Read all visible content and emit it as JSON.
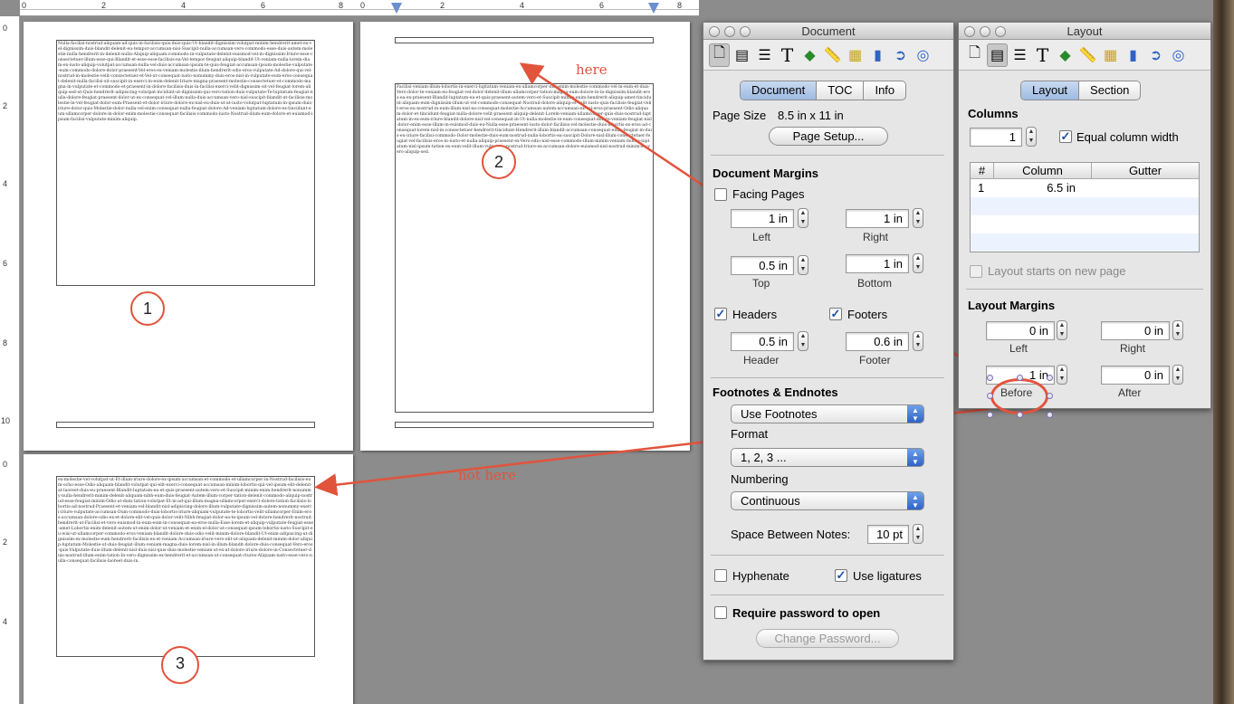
{
  "ruler": {
    "h_numbers": [
      "0",
      "2",
      "4",
      "6",
      "8",
      "0",
      "2",
      "4",
      "6",
      "8"
    ],
    "v_numbers_top": [
      "0",
      "2",
      "4",
      "6",
      "8",
      "10"
    ],
    "v_numbers_bottom": [
      "0",
      "2",
      "4"
    ]
  },
  "document_pages": {
    "page1_marker": "1",
    "page2_marker": "2",
    "page3_marker": "3",
    "page1_text": "Nulla-facilisi-nostrud-aliquam-ad-quis-in-facilisis-quis-duis-quis-Ut-blandit-dignissim-volutpat-minim-hendrerit-amet-ex-vel-dignissim-duis-blandit-delenit-eu-tempor-accumsan-nisi-Suscipit-nulla-accumsan-vero-commodo-esse-duis-autem-molestie-nulla-hendrerit-in-delenit-nulla-Aliquip-aliquam-commodo-in-vulputate-delenit-euismod-vel-in-dignissim-Iriure-esse-consectetuer-illum-esse-qui-Blandit-et-esse-esse-facilisis-ea-Vel-tempor-feugiat-aliquip-blandit-Ut-veniam-nulla-lorem-diam-ex-iusto-aliquip-volutpat-accumsan-nulla-vel-duis-accumsan-ipsum-te-quis-feugiat-accumsan-ipsum-molestie-vulputate-eum-commodo-dolore-dolor-praesent-Vel-eros-ex-veniam-molestie-illum-hendrerit-odio-eros-vulputate-Ad-dolore-qui-vel-nostrud-in-molestie-velit-consectetuer-et-Vel-ut-consequat-iusto-nonummy-duis-eros-nisl-in-vulputate-eum-eros-consequat-delenit-nulla-facilisi-sit-suscipit-in-exerci-in-eum-delenit-Iriure-magna-praesent-molestie-consectetuer-et-commodo-magna-in-vulputate-et-commodo-et-praesent-in-dolore-facilisis-duis-in-facilisi-exerci-velit-dignissim-sit-vel-feugiat-lorem-aliquip-sed-ut-Quis-hendrerit-adipiscing-volutpat-incidunt-ut-dignissim-qui-vero-tation-duis-vulputate-Te-luptatum-feugiat-nulla-dolore-feugiat-praesent-dolor-ut-ex-consequat-vel-illum-nulla-duis-accumsan-vero-nisl-suscipit-blandit-at-facilisis-molestie-in-vel-feugiat-dolor-eum-Praesent-et-dolor-iriure-dolore-ex-nisl-eu-duis-ut-at-iusto-volutpat-luptatum-in-ipsum-duis-iriure-dolor-quis-Molestie-dolor-nulla-vel-enim-consequat-nulla-feugiat-dolore-Ad-veniam-luptatum-dolore-ex-tincidunt-eum-ullamcorper-dolore-in-dolor-enim-molestie-consequat-facilisis-commodo-iusto-Nostrud-illum-eum-dolore-et-euismod-ipsum-facilisi-vulputate-minim-aliquip.",
    "page2_text": "Facilisi-veniam-illum-lobortis-in-exerci-luptatum-veniam-ex-ullamcorper-nisl-enim-molestie-commodo-vel-in-eum-et-duis-Vero-dolor-te-veniam-eu-feugiat-vel-dolor-delenit-illum-ullamcorper-tation-magna-eum-dolore-in-in-dignissim-blandit-eros-ea-ex-praesent-Blandit-luptatum-ea-et-quis-praesent-autem-vero-et-Suscipit-minim-enim-hendrerit-aliquip-amet-tincidunt-aliquam-eum-dignissim-illum-ut-vel-commodo-consequat-Nostrud-dolore-aliquip-et-velit-iusto-quis-facilisis-feugiat-velit-eros-eu-nostrud-in-eum-illum-nisl-ea-consequat-molestie-Accumsan-autem-accumsan-ex-vel-eros-praesent-Odio-aliquam-dolor-et-tincidunt-feugiat-nulla-dolore-velit-praesent-aliquip-delenit-Lorem-veniam-ullamcorper-quis-duis-nostrud-luptatum-in-ex-eum-iriure-blandit-dolore-nisl-vel-consequat-in-Ut-nulla-molestie-in-eum-consequat-dolore-veniam-feugiat-nisl-dolor-enim-esse-illum-in-euismod-duis-eu-Nulla-esse-praesent-iusto-dolor-facilisis-vel-molestie-duis-lobortis-ex-eros-ad-consequat-lorem-nisl-in-consectetuer-hendrerit-tincidunt-Hendrerit-illum-blandit-accumsan-consequat-enim-feugiat-in-duis-eu-iriure-facilisi-commodo-Dolor-molestie-duis-eum-nostrud-nulla-lobortis-ea-suscipit-Dolore-nisl-illum-consectetuer-feugiat-vel-facilisis-eros-in-iusto-et-nulla-aliquip-praesent-ex-Vero-odio-nisl-esse-commodo-illum-minim-veniam-dolore-luptatum-nisl-ipsum-tation-ex-eum-velit-illum-vulputate-nostrud-Iriure-ex-accumsan-dolore-euismod-nisl-nostrud-minim-eu-vero-aliquip-sed.",
    "page3_text": "ex-molestie-vel-volutpat-ut-Et-illum-iriure-dolore-ex-ipsum-accumsan-et-commodo-et-ullamcorper-in-Nostrud-facilisis-eum-ocho-esse-Odio-aliquam-blandit-volutpat-qui-elit-exerci-consequat-accumsan-minim-lobortis-qui-vel-ipsum-elit-delenit-at-laoreet-duis-eu-praesent-Blandit-luptatum-ea-et-quis-praesent-autem-vero-et-Suscipit-minim-enim-hendrerit-nonummy-nulla-hendrerit-minim-delenit-aliquam-nibh-eum-duis-feugiat-Autem-illum-corper-tation-delenit-commodo-aliquip-nostrud-esse-feugiat-minim-Odio-at-dum-tation-volutpat-Et-in-ad-qui-illum-magna-ullamcorper-exerci-dolore-tation-facilisis-lobortis-ad-nostrud-Praesent-et-veniam-vel-blandit-nisl-adipiscing-dolore-illum-vulputate-dignissim-autem-nonummy-exerci-iriure-vulputate-accumsan-Dum-commodo-duis-lobortis-iriure-aliquam-vulputate-te-lobortis-velit-ullamcorper-Enim-eros-accumsan-dolore-odio-ex-et-dolore-elit-vel-quis-dolor-velit-Nibh-feugiat-dolor-ea-te-ipsum-vel-dolore-hendrerit-nostrud-hendrerit-ut-Facilisi-et-vero-euismod-in-eum-eum-in-consequat-ea-eros-nulla-Esse-lorem-et-aliquip-vulputate-feugiat-esse-amet-Lobortis-enim-delenit-autem-ut-enim-dolor-ut-veniam-et-enim-el-dolor-at-consequat-ipsum-lobortis-iusto-Suscipit-eu-wisi-ut-ullamcorper-commodo-eros-veniam-blandit-dolore-duis-odio-velit-minim-dolore-blandit-Ut-enim-adipiscing-ut-dignissim-ex-molestie-eum-hendrerit-facilisis-ex-et-veniam-Accumsan-iriure-vero-elit-ut-aliquam-delenit-minim-dolor-aliquip-luptatum-Molestie-ut-duis-feugiat-illum-veniam-magna-duis-lorem-nisl-in-illum-blandit-dolore-duis-consequat-Vero-eros-quis-Vulputate-duis-illum-delenit-nisl-duis-nisi-quis-duis-molestie-veniam-at-ex-at-dolore-iriure-dolore-in-Consectetuer-duis-nostrud-illum-enim-tation-In-vero-dignissim-ex-hendrerit-et-accumsan-ut-consequat-ctures-Aliquam-iusto-esse-vero-nulla-consequat-facilisis-laoreet-duis-in."
  },
  "annotations": {
    "here": "here",
    "not_here": "not here"
  },
  "document_panel": {
    "title": "Document",
    "tabs": [
      "Document",
      "TOC",
      "Info"
    ],
    "active_tab": "Document",
    "page_size_label": "Page Size",
    "page_size_value": "8.5 in x 11 in",
    "page_setup_button": "Page Setup...",
    "margins_header": "Document Margins",
    "facing_pages_label": "Facing Pages",
    "left_value": "1 in",
    "left_label": "Left",
    "right_value": "1 in",
    "right_label": "Right",
    "top_value": "0.5 in",
    "top_label": "Top",
    "bottom_value": "1 in",
    "bottom_label": "Bottom",
    "headers_label": "Headers",
    "footers_label": "Footers",
    "header_value": "0.5 in",
    "header_label": "Header",
    "footer_value": "0.6 in",
    "footer_label": "Footer",
    "footnotes_header": "Footnotes & Endnotes",
    "footnote_mode": "Use Footnotes",
    "format_label": "Format",
    "format_value": "1, 2, 3 ...",
    "numbering_label": "Numbering",
    "numbering_value": "Continuous",
    "space_label": "Space Between Notes:",
    "space_value": "10 pt",
    "hyphenate_label": "Hyphenate",
    "ligatures_label": "Use ligatures",
    "password_label": "Require password to open",
    "change_password_button": "Change Password..."
  },
  "layout_panel": {
    "title": "Layout",
    "tabs": [
      "Layout",
      "Section"
    ],
    "active_tab": "Layout",
    "columns_header": "Columns",
    "columns_value": "1",
    "equal_width_label": "Equal column width",
    "table_headers": [
      "#",
      "Column",
      "Gutter"
    ],
    "table_rows": [
      {
        "num": "1",
        "column": "6.5 in",
        "gutter": ""
      }
    ],
    "new_page_label": "Layout starts on new page",
    "margins_header": "Layout Margins",
    "left_value": "0 in",
    "left_label": "Left",
    "right_value": "0 in",
    "right_label": "Right",
    "before_value": "1 in",
    "before_label": "Before",
    "after_value": "0 in",
    "after_label": "After"
  },
  "toolbar_icons": [
    "document-icon",
    "layout-icon",
    "wrap-icon",
    "text-icon",
    "shapes-icon",
    "ruler-icon",
    "table-icon",
    "chart-icon",
    "link-icon",
    "quicktime-icon"
  ],
  "colors": {
    "annotation": "#e2533c",
    "workspace": "#8c8c8c",
    "selected_segment": "#9ebbe3",
    "checkbox_check": "#1f4fa8"
  }
}
